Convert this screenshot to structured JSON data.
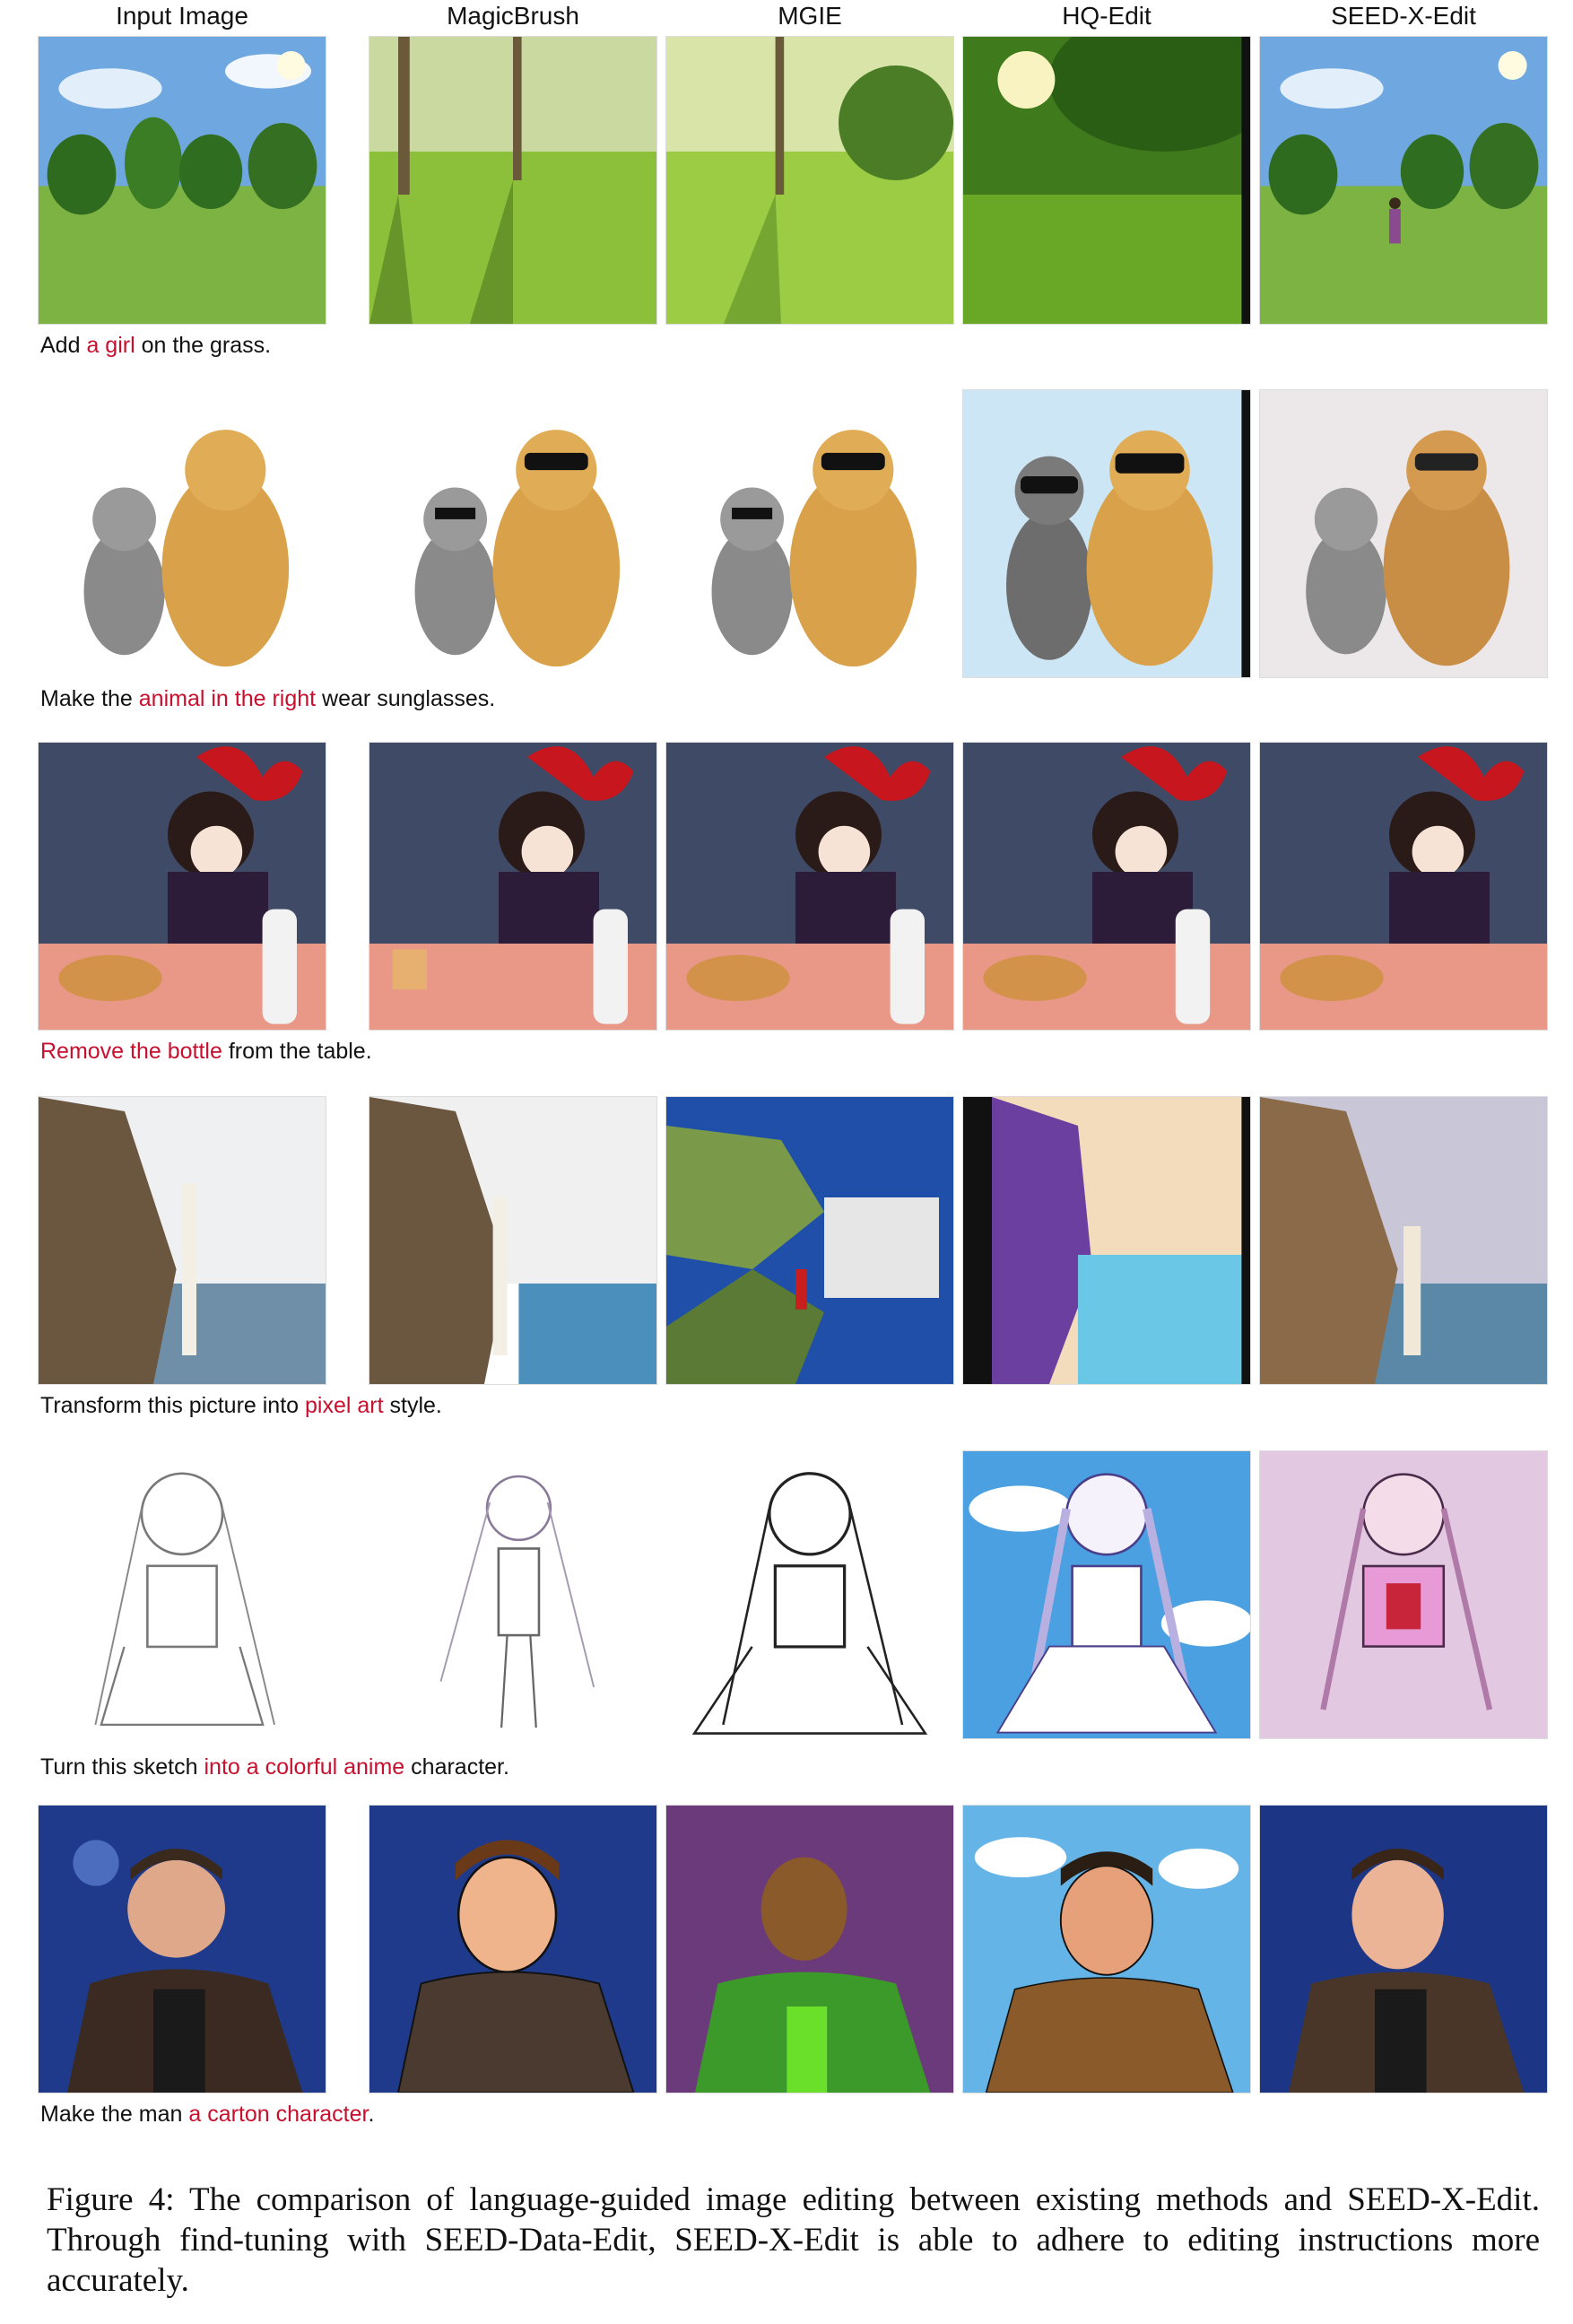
{
  "columns": [
    "Input Image",
    "MagicBrush",
    "MGIE",
    "HQ-Edit",
    "SEED-X-Edit"
  ],
  "rows": [
    {
      "caption": {
        "before": "Add ",
        "highlight": "a girl",
        "after": " on the grass."
      }
    },
    {
      "caption": {
        "before": "Make the ",
        "highlight": "animal in the right",
        "after": " wear sunglasses."
      }
    },
    {
      "caption": {
        "before": "",
        "highlight": "Remove the bottle",
        "after": " from the table."
      }
    },
    {
      "caption": {
        "before": "Transform this picture into ",
        "highlight": "pixel art",
        "after": " style."
      }
    },
    {
      "caption": {
        "before": "Turn this sketch ",
        "highlight": "into a colorful anime",
        "after": " character."
      }
    },
    {
      "caption": {
        "before": "Make the man ",
        "highlight": "a carton character",
        "after": "."
      }
    }
  ],
  "figure_caption": "Figure 4: The comparison of language-guided image editing between existing methods and SEED-X-Edit. Through find-tuning with SEED-Data-Edit, SEED-X-Edit is able to adhere to editing instructions more accurately.",
  "colors": {
    "highlight": "#c8102e"
  }
}
